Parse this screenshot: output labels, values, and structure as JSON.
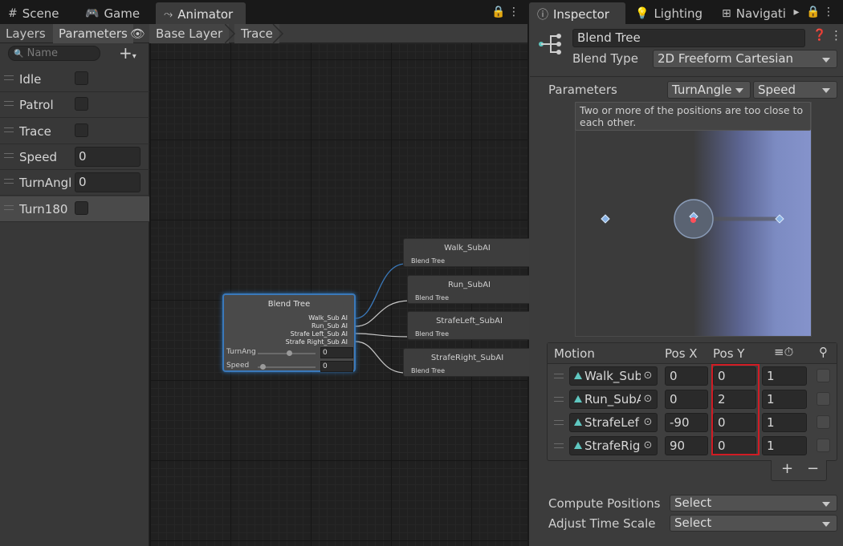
{
  "tabs_left": {
    "scene": "Scene",
    "game": "Game",
    "animator": "Animator"
  },
  "tabs_right": {
    "inspector": "Inspector",
    "lighting": "Lighting",
    "navigation": "Navigati"
  },
  "animator": {
    "layers_tab": "Layers",
    "parameters_tab": "Parameters",
    "breadcrumb": [
      "Base Layer",
      "Trace"
    ],
    "search_placeholder": "Name",
    "parameters": [
      {
        "name": "Idle",
        "type": "bool"
      },
      {
        "name": "Patrol",
        "type": "bool"
      },
      {
        "name": "Trace",
        "type": "bool"
      },
      {
        "name": "Speed",
        "type": "float",
        "value": "0"
      },
      {
        "name": "TurnAngl",
        "type": "float",
        "value": "0"
      },
      {
        "name": "Turn180",
        "type": "bool"
      }
    ]
  },
  "graph": {
    "blend_tree": {
      "title": "Blend Tree",
      "outputs": [
        "Walk_Sub AI",
        "Run_Sub AI",
        "Strafe Left_Sub AI",
        "Strafe Right_Sub AI"
      ],
      "params": [
        {
          "name": "TurnAng",
          "value": "0"
        },
        {
          "name": "Speed",
          "value": "0"
        }
      ]
    },
    "children": [
      {
        "title": "Walk_SubAI",
        "sub": "Blend Tree"
      },
      {
        "title": "Run_SubAI",
        "sub": "Blend Tree"
      },
      {
        "title": "StrafeLeft_SubAI",
        "sub": "Blend Tree"
      },
      {
        "title": "StrafeRight_SubAI",
        "sub": "Blend Tree"
      }
    ]
  },
  "inspector": {
    "name": "Blend Tree",
    "blend_type_label": "Blend Type",
    "blend_type": "2D Freeform Cartesian",
    "parameters_label": "Parameters",
    "param_x": "TurnAngle",
    "param_y": "Speed",
    "warning": "Two or more of the positions are too close to each other.",
    "motion_header": {
      "motion": "Motion",
      "pos_x": "Pos X",
      "pos_y": "Pos Y"
    },
    "motions": [
      {
        "name": "Walk_Sub",
        "pos_x": "0",
        "pos_y": "0",
        "speed": "1"
      },
      {
        "name": "Run_SubA",
        "pos_x": "0",
        "pos_y": "2",
        "speed": "1"
      },
      {
        "name": "StrafeLef",
        "pos_x": "-90",
        "pos_y": "0",
        "speed": "1"
      },
      {
        "name": "StrafeRig",
        "pos_x": "90",
        "pos_y": "0",
        "speed": "1"
      }
    ],
    "add_button": "+",
    "remove_button": "−",
    "compute_positions_label": "Compute Positions",
    "compute_positions_value": "Select",
    "adjust_time_scale_label": "Adjust Time Scale",
    "adjust_time_scale_value": "Select"
  },
  "colors": {
    "accent_blue": "#3a79bb",
    "highlight_red": "#d01c24",
    "motion_icon": "#5fc7c0"
  }
}
